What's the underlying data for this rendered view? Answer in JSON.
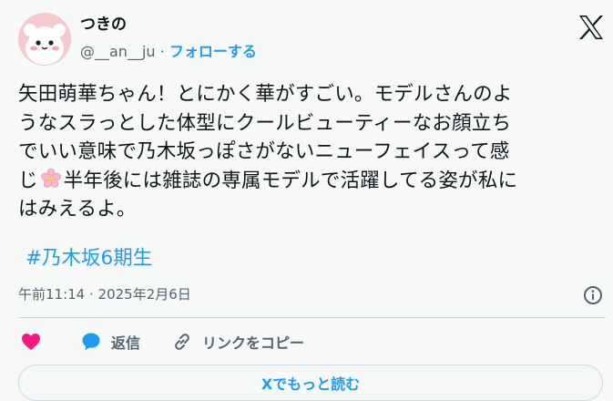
{
  "author": {
    "display_name": "つきの",
    "handle": "@__an__ju",
    "separator": "·",
    "follow_label": "フォローする",
    "avatar_icon": "chiikawa-avatar-icon"
  },
  "brand": {
    "icon": "x-logo-icon"
  },
  "tweet": {
    "lines": [
      "矢田萌華ちゃん！とにかく華がすごい。モデルさんのよ",
      "うなスラっとした体型にクールビューティーなお顔立ち",
      "でいい意味で乃木坂っぽさがないニューフェイスって感",
      "じ",
      "半年後には雑誌の専属モデルで活躍してる姿が私に",
      "はみえるよ。"
    ],
    "emoji": "cherry-blossom-icon",
    "hashtag": "#乃木坂6期生"
  },
  "meta": {
    "timestamp": "午前11:14 · 2025年2月6日",
    "info_icon": "info-icon"
  },
  "actions": {
    "like_icon": "heart-icon",
    "reply_icon": "speech-bubble-icon",
    "reply_label": "返信",
    "copy_link_icon": "link-icon",
    "copy_link_label": "リンクをコピー"
  },
  "read_more_label": "Xでもっと読む",
  "colors": {
    "background": "#f7f9f9",
    "text": "#0f1419",
    "muted": "#536471",
    "accent": "#1d9bf0",
    "like": "#f91880",
    "border": "#cfd9de"
  }
}
